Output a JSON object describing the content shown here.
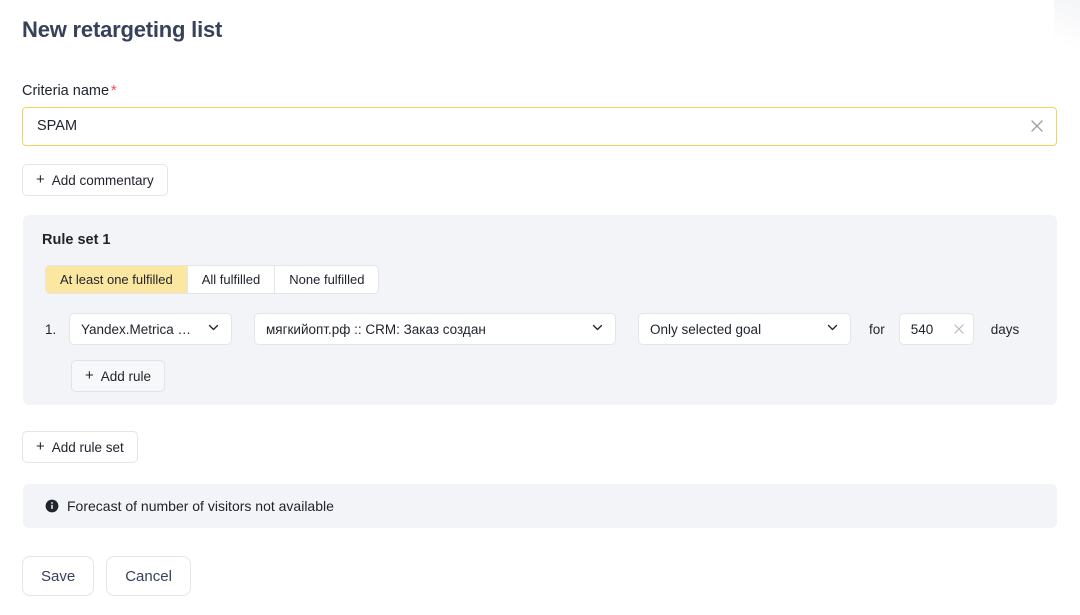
{
  "page": {
    "title": "New retargeting list"
  },
  "criteria": {
    "label": "Criteria name",
    "required_mark": "*",
    "value": "SPAM",
    "placeholder": "",
    "clear_icon": "close-x-icon"
  },
  "commentary": {
    "plus": "+",
    "label": "Add commentary"
  },
  "ruleset": {
    "title": "Rule set 1",
    "segments": [
      {
        "label": "At least one fulfilled",
        "active": true
      },
      {
        "label": "All fulfilled",
        "active": false
      },
      {
        "label": "None fulfilled",
        "active": false
      }
    ],
    "rule": {
      "number": "1.",
      "source": {
        "value": "Yandex.Metrica goal",
        "chevron_icon": "chevron-down-icon"
      },
      "goal": {
        "value": "мягкийопт.рф :: CRM: Заказ создан",
        "chevron_icon": "chevron-down-icon"
      },
      "scope": {
        "value": "Only selected goal",
        "chevron_icon": "chevron-down-icon"
      },
      "for_word": "for",
      "days_value": "540",
      "days_clear_icon": "close-x-icon",
      "days_word": "days"
    },
    "add_rule": {
      "plus": "+",
      "label": "Add rule"
    }
  },
  "add_ruleset": {
    "plus": "+",
    "label": "Add rule set"
  },
  "forecast": {
    "icon": "info-circle-icon",
    "text": "Forecast of number of visitors not available"
  },
  "footer": {
    "save_label": "Save",
    "cancel_label": "Cancel"
  },
  "colors": {
    "accent_yellow": "#f2d361",
    "segment_active": "#fbe79f",
    "panel_bg": "#f2f4f7",
    "text_dark": "#20242c",
    "title_navy": "#37415a",
    "required_red": "#f04c4c",
    "border_gray": "#e3e5ea"
  }
}
